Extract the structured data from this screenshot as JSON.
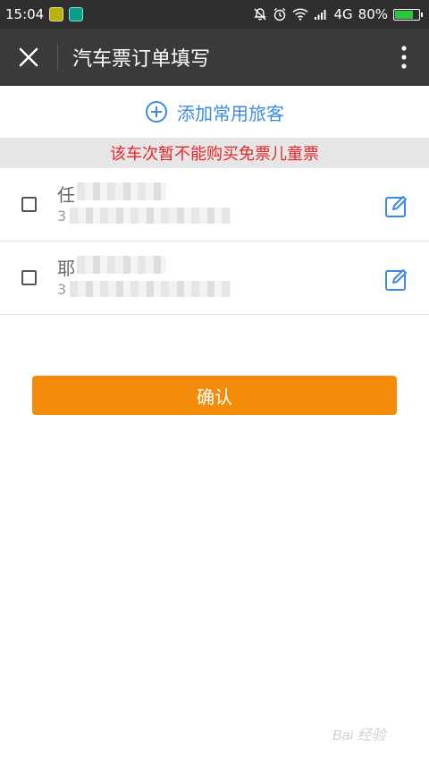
{
  "status_bar": {
    "time": "15:04",
    "network": "4G",
    "battery": "80%",
    "battery_level": 0.8
  },
  "header": {
    "title": "汽车票订单填写",
    "icons": {
      "close": "close-icon",
      "more": "more-vertical-icon"
    }
  },
  "add_passenger": {
    "label": "添加常用旅客",
    "icon": "plus-circle-icon"
  },
  "notice": {
    "text": "该车次暂不能购买免票儿童票",
    "color": "#e8262a"
  },
  "passengers": [
    {
      "name_visible": "任",
      "id_visible": "3"
    },
    {
      "name_visible": "耶",
      "id_visible": "3"
    }
  ],
  "confirm": {
    "label": "确认",
    "color": "#f28c0a"
  },
  "colors": {
    "accent_blue": "#3d8be0",
    "header_bg": "#3a3a3a",
    "status_bg": "#2f2f2f"
  },
  "watermark": "Bai 经验"
}
